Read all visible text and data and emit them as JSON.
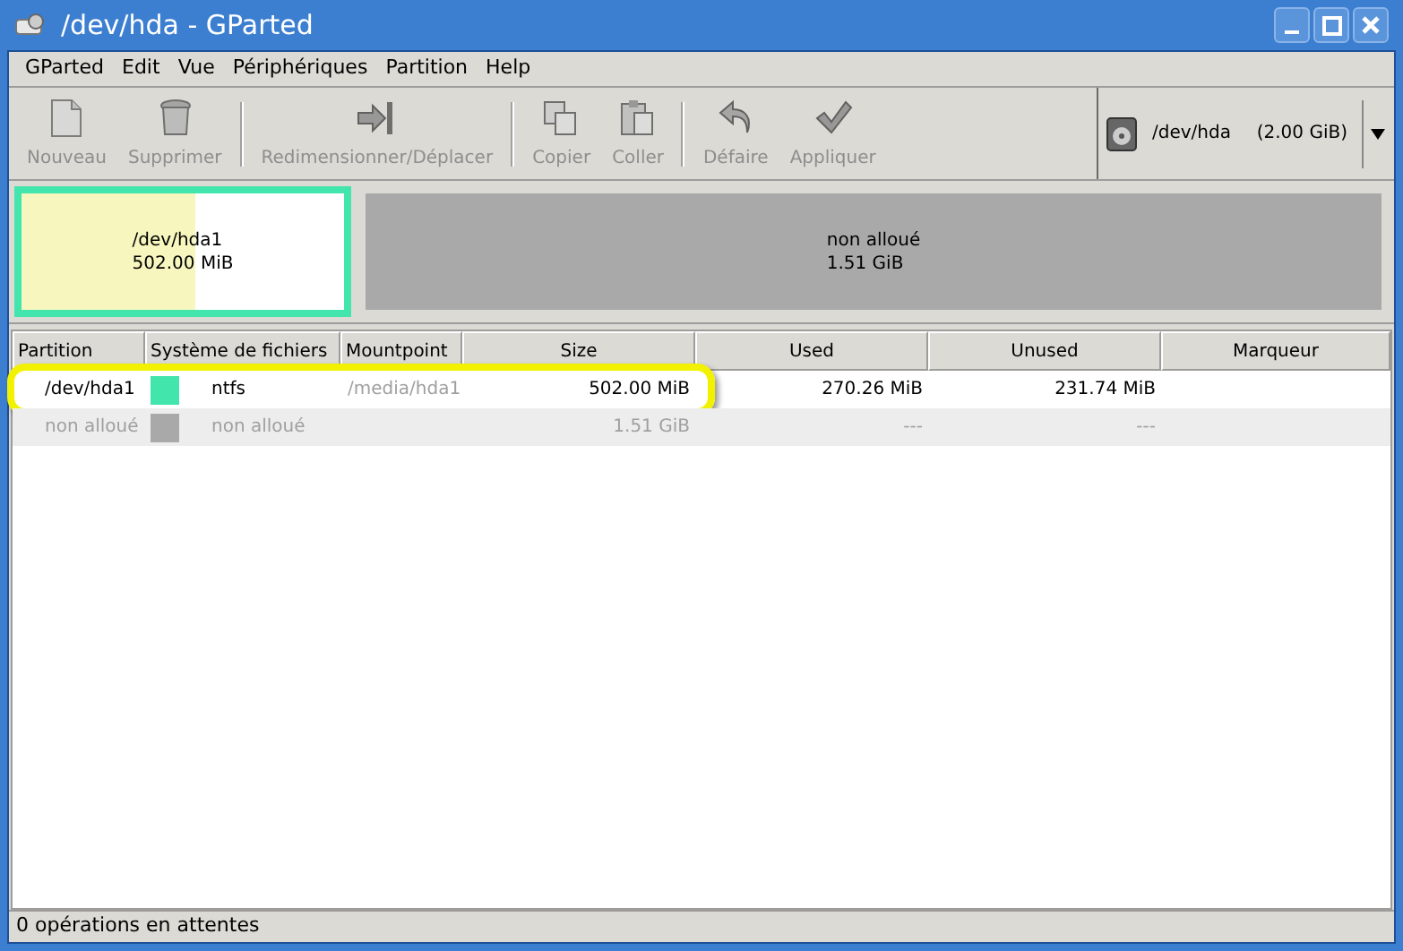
{
  "window": {
    "title": "/dev/hda - GParted"
  },
  "menu": [
    "GParted",
    "Edit",
    "Vue",
    "Périphériques",
    "Partition",
    "Help"
  ],
  "toolbar": [
    {
      "kind": "button",
      "label": "Nouveau",
      "disabled": true
    },
    {
      "kind": "button",
      "label": "Supprimer",
      "disabled": true
    },
    {
      "kind": "separator"
    },
    {
      "kind": "button",
      "label": "Redimensionner/Déplacer",
      "disabled": true
    },
    {
      "kind": "separator"
    },
    {
      "kind": "button",
      "label": "Copier",
      "disabled": true
    },
    {
      "kind": "button",
      "label": "Coller",
      "disabled": true
    },
    {
      "kind": "separator"
    },
    {
      "kind": "button",
      "label": "Défaire",
      "disabled": true
    },
    {
      "kind": "button",
      "label": "Appliquer",
      "disabled": true
    }
  ],
  "device": {
    "name": "/dev/hda",
    "size": "(2.00 GiB)"
  },
  "disk_map": [
    {
      "kind": "partition",
      "name": "/dev/hda1",
      "size": "502.00 MiB",
      "color": "#42e5ac",
      "level": 0.54,
      "selected": true
    },
    {
      "kind": "unallocated",
      "name": "non alloué",
      "size": "1.51 GiB",
      "color": "#a9a9a9",
      "selected": false
    }
  ],
  "table": {
    "columns": [
      "Partition",
      "Système de fichiers",
      "Mountpoint",
      "Size",
      "Used",
      "Unused",
      "Marqueur"
    ],
    "rows": [
      {
        "kind": "partition",
        "partition": "/dev/hda1",
        "color": "#42e5ac",
        "filesystem": "ntfs",
        "mountpoint": "/media/hda1",
        "size": "502.00 MiB",
        "used": "270.26 MiB",
        "unused": "231.74 MiB",
        "highlighted": true
      },
      {
        "kind": "unallocated",
        "partition": "non alloué",
        "color": "#a9a9a9",
        "filesystem": "non alloué",
        "size": "1.51 GiB",
        "used": "---",
        "unused": "---",
        "highlighted": false
      }
    ]
  },
  "status_bar": "0 opérations en attentes"
}
